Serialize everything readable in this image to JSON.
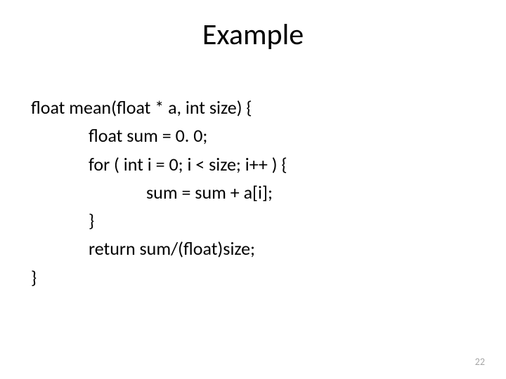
{
  "title": "Example",
  "code": {
    "l1": "float mean(float * a, int size) {",
    "l2": "float sum = 0. 0;",
    "l3": "for ( int i = 0; i < size; i++ ) {",
    "l4": "sum = sum + a[i];",
    "l5": "}",
    "l6": "return sum/(float)size;",
    "l7": "}"
  },
  "page_number": "22"
}
